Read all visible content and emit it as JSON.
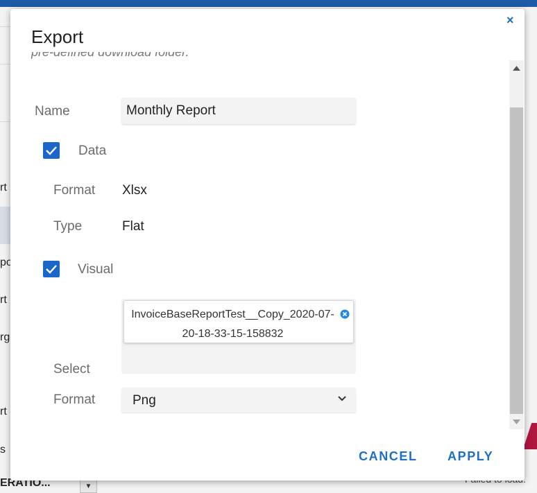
{
  "background": {
    "side_fragments": [
      "rt",
      "po",
      "rt",
      "rge",
      "rt",
      "s"
    ],
    "combo_text": "ERATIO...",
    "failed_text": "Failed to load."
  },
  "dialog": {
    "title": "Export",
    "close_symbol": "×",
    "cutoff_text": "pre-defined download folder.",
    "name": {
      "label": "Name",
      "value": "Monthly Report"
    },
    "data_section": {
      "label": "Data",
      "checked": true,
      "format_label": "Format",
      "format_value": "Xlsx",
      "type_label": "Type",
      "type_value": "Flat"
    },
    "visual_section": {
      "label": "Visual",
      "checked": true,
      "select_label": "Select",
      "selected_chip": "InvoiceBaseReportTest__Copy_2020-07-20-18-33-15-158832",
      "format_label": "Format",
      "format_value": "Png"
    },
    "buttons": {
      "cancel": "CANCEL",
      "apply": "APPLY"
    }
  },
  "colors": {
    "accent": "#1d6fc5",
    "checkbox": "#1b67c9",
    "header": "#1d5aa7"
  },
  "icons": [
    "close-icon",
    "checkmark-icon",
    "remove-chip-icon",
    "chevron-down-icon",
    "scroll-up-icon",
    "scroll-down-icon"
  ]
}
